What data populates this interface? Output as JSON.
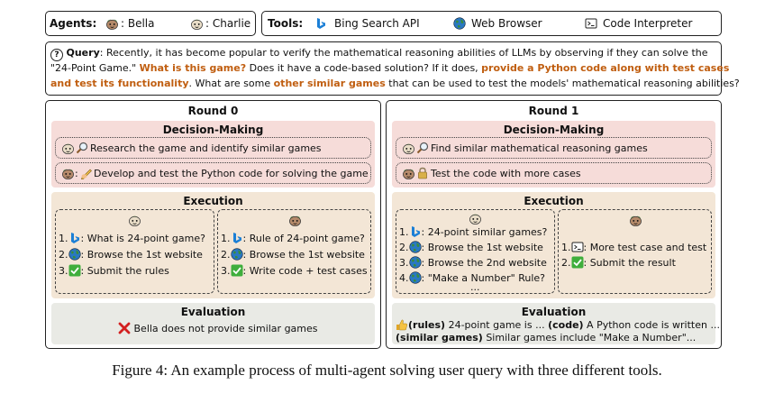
{
  "header": {
    "agents_label": "Agents:",
    "agents": [
      {
        "name": ": Bella"
      },
      {
        "name": ": Charlie"
      }
    ],
    "tools_label": "Tools:",
    "tools": [
      {
        "name": "Bing Search API",
        "icon": "bing-icon"
      },
      {
        "name": "Web Browser",
        "icon": "globe-icon"
      },
      {
        "name": "Code Interpreter",
        "icon": "terminal-icon"
      }
    ]
  },
  "query": {
    "label": "Query",
    "part1": ": Recently, it has become popular to verify the mathematical reasoning abilities of LLMs by observing if they can solve the",
    "part2": "\"24-Point Game.\" ",
    "hl1": "What is this game?",
    "part3": " Does it have a code-based solution? If it does, ",
    "hl2": "provide a Python code along with test cases",
    "hl2b": "and test its functionality",
    "part4": ". What are some ",
    "hl3": "other similar games",
    "part5": " that can be used to test the models' mathematical reasoning abilities?"
  },
  "rounds": [
    {
      "title": "Round 0",
      "decision_title": "Decision-Making",
      "decisions": [
        {
          "text": "Research the game and identify similar games"
        },
        {
          "text": "Develop and test the Python code for solving the game"
        }
      ],
      "execution_title": "Execution",
      "left_steps": [
        "1.",
        ": What is 24-point game?",
        "2.",
        ": Browse the 1st website",
        "3.",
        ": Submit the rules"
      ],
      "right_steps": [
        "1.",
        ": Rule of 24-point game?",
        "2.",
        ": Browse the 1st website",
        "3.",
        ": Write code + test cases"
      ],
      "evaluation_title": "Evaluation",
      "evaluation": "Bella does not provide similar games"
    },
    {
      "title": "Round 1",
      "decision_title": "Decision-Making",
      "decisions": [
        {
          "text": "Find similar mathematical reasoning games"
        },
        {
          "text": "Test the code with more cases"
        }
      ],
      "execution_title": "Execution",
      "left_steps": [
        "1.",
        ": 24-point similar games?",
        "2.",
        ": Browse the 1st website",
        "3.",
        ": Browse the 2nd website",
        "4.",
        ": \"Make a Number\" Rule?",
        "..."
      ],
      "right_steps": [
        "1.",
        ": More test case and test",
        "2.",
        ": Submit the result"
      ],
      "evaluation_title": "Evaluation",
      "eval_line1_a": "(rules)",
      "eval_line1_b": " 24-point game is ... ",
      "eval_line1_c": "(code)",
      "eval_line1_d": " A Python code is written ...",
      "eval_line2_a": "(similar games)",
      "eval_line2_b": " Similar games include \"Make a Number\"..."
    }
  ],
  "caption": "Figure 4: An example process of multi-agent solving user query with three different tools.",
  "colors": {
    "highlight": "#c05e10",
    "decision_bg": "#f6dcd9",
    "execution_bg": "#f3e6d6",
    "evaluation_bg": "#e9eae5"
  }
}
